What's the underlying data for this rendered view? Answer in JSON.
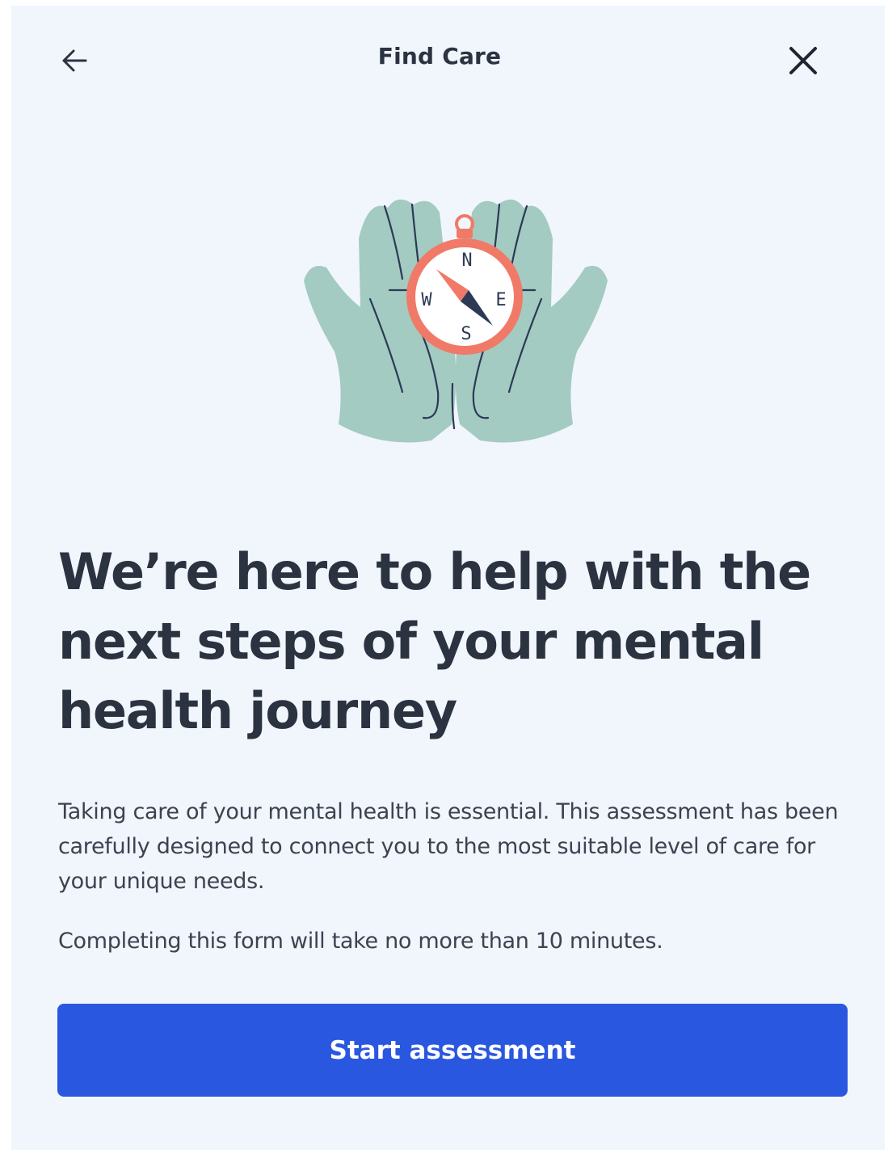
{
  "header": {
    "title": "Find Care",
    "back_icon": "arrow-left-icon",
    "close_icon": "close-icon"
  },
  "illustration": {
    "icon": "hands-holding-compass-illustration",
    "compass": {
      "north": "N",
      "south": "S",
      "east": "E",
      "west": "W"
    }
  },
  "content": {
    "headline": "We’re here to help with the next steps of your mental health journey",
    "description": "Taking care of your mental health is essential. This assessment has been carefully designed to connect you to the most suitable level of care for your unique needs.",
    "duration": "Completing this form will take no more than 10 minutes."
  },
  "actions": {
    "start_label": "Start assessment"
  },
  "colors": {
    "background": "#f1f5fc",
    "text_dark": "#2b3240",
    "primary_button": "#2a57e0",
    "hand_green": "#a3cbc1",
    "compass_coral": "#f07a67",
    "needle_navy": "#2c3a55"
  }
}
